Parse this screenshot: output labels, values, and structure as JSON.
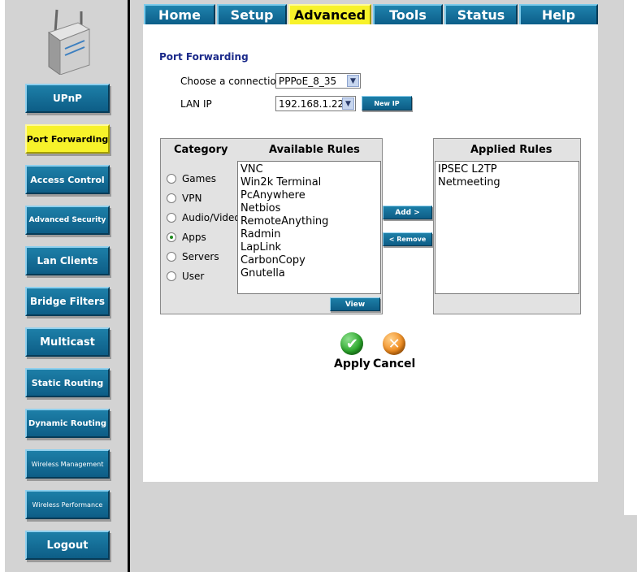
{
  "tabs": [
    {
      "label": "Home"
    },
    {
      "label": "Setup"
    },
    {
      "label": "Advanced"
    },
    {
      "label": "Tools"
    },
    {
      "label": "Status"
    },
    {
      "label": "Help"
    }
  ],
  "active_tab": "Advanced",
  "sidebar": {
    "items": [
      {
        "label": "UPnP"
      },
      {
        "label": "Port Forwarding"
      },
      {
        "label": "Access Control"
      },
      {
        "label": "Advanced Security"
      },
      {
        "label": "Lan Clients"
      },
      {
        "label": "Bridge Filters"
      },
      {
        "label": "Multicast"
      },
      {
        "label": "Static Routing"
      },
      {
        "label": "Dynamic Routing"
      },
      {
        "label": "Wireless Management"
      },
      {
        "label": "Wireless Performance"
      },
      {
        "label": "Logout"
      }
    ],
    "active_item": "Port Forwarding"
  },
  "port_forwarding": {
    "title": "Port Forwarding",
    "connection_label": "Choose a connection",
    "connection_value": "PPPoE_8_35",
    "lan_ip_label": "LAN IP",
    "lan_ip_value": "192.168.1.22",
    "new_ip_button": "New IP"
  },
  "rules": {
    "category_header": "Category",
    "available_header": "Available Rules",
    "applied_header": "Applied Rules",
    "categories": [
      {
        "label": "Games",
        "selected": false
      },
      {
        "label": "VPN",
        "selected": false
      },
      {
        "label": "Audio/Video",
        "selected": false
      },
      {
        "label": "Apps",
        "selected": true
      },
      {
        "label": "Servers",
        "selected": false
      },
      {
        "label": "User",
        "selected": false
      }
    ],
    "available": [
      "VNC",
      "Win2k Terminal",
      "PcAnywhere",
      "Netbios",
      "RemoteAnything",
      "Radmin",
      "LapLink",
      "CarbonCopy",
      "Gnutella"
    ],
    "applied": [
      "IPSEC L2TP",
      "Netmeeting"
    ],
    "add_button": "Add >",
    "remove_button": "< Remove",
    "view_button": "View"
  },
  "actions": {
    "apply_label": "Apply",
    "cancel_label": "Cancel"
  },
  "colors": {
    "nav_blue": "#1d7fa8",
    "active_yellow": "#f7f22a",
    "title_blue": "#1b2a8a",
    "apply_green": "#2aa82a",
    "cancel_orange": "#f08a1c"
  }
}
